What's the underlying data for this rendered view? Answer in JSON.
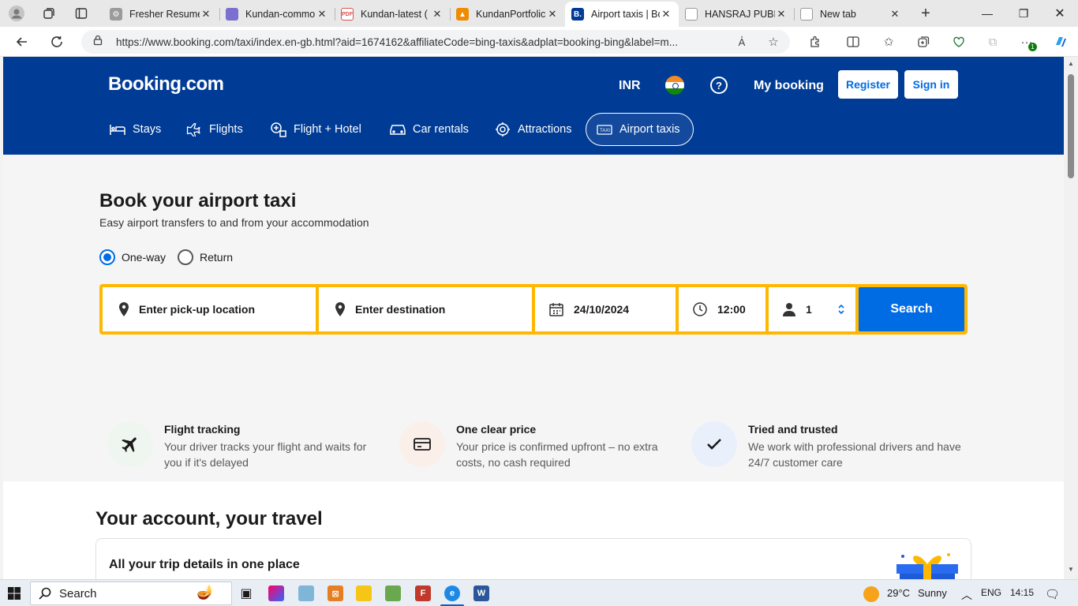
{
  "browser": {
    "tabs": [
      {
        "title": "Fresher Resume",
        "favicon": "gear-icon",
        "color": "#888888"
      },
      {
        "title": "Kundan-commo",
        "favicon": "doc-icon",
        "color": "#7b6fd0"
      },
      {
        "title": "Kundan-latest (",
        "favicon": "pdf-icon",
        "color": "#d9534f"
      },
      {
        "title": "KundanPortfolic",
        "favicon": "portfolio-icon",
        "color": "#f08a00"
      },
      {
        "title": "Airport taxis | Bo",
        "favicon": "booking-icon",
        "color": "#003b95",
        "active": true
      },
      {
        "title": "HANSRAJ PUBL",
        "favicon": "page-icon",
        "color": "#999999"
      },
      {
        "title": "New tab",
        "favicon": "newtab-icon",
        "color": "#999999"
      }
    ],
    "url": "https://www.booking.com/taxi/index.en-gb.html?aid=1674162&affiliateCode=bing-taxis&adplat=booking-bing&label=m...",
    "extension_badge": "1"
  },
  "header": {
    "logo": "Booking.com",
    "currency": "INR",
    "help": "?",
    "my_booking": "My booking",
    "register": "Register",
    "sign_in": "Sign in",
    "brand_color": "#003b95"
  },
  "nav": [
    {
      "label": "Stays",
      "icon": "bed-icon"
    },
    {
      "label": "Flights",
      "icon": "plane-icon"
    },
    {
      "label": "Flight + Hotel",
      "icon": "plane-hotel-icon"
    },
    {
      "label": "Car rentals",
      "icon": "car-icon"
    },
    {
      "label": "Attractions",
      "icon": "attractions-icon"
    },
    {
      "label": "Airport taxis",
      "icon": "taxi-icon",
      "active": true
    }
  ],
  "hero": {
    "title": "Book your airport taxi",
    "subtitle": "Easy airport transfers to and from your accommodation",
    "trip_types": [
      {
        "label": "One-way",
        "selected": true
      },
      {
        "label": "Return",
        "selected": false
      }
    ]
  },
  "search": {
    "pickup_placeholder": "Enter pick-up location",
    "destination_placeholder": "Enter destination",
    "date": "24/10/2024",
    "time": "12:00",
    "passengers": "1",
    "button": "Search",
    "accent": "#ffb700",
    "button_color": "#006ce4"
  },
  "features": [
    {
      "title": "Flight tracking",
      "desc": "Your driver tracks your flight and waits for you if it's delayed",
      "icon": "plane-icon",
      "bg": "#eef6ef"
    },
    {
      "title": "One clear price",
      "desc": "Your price is confirmed upfront – no extra costs, no cash required",
      "icon": "card-icon",
      "bg": "#fbefe9"
    },
    {
      "title": "Tried and trusted",
      "desc": "We work with professional drivers and have 24/7 customer care",
      "icon": "check-icon",
      "bg": "#eaf0fb"
    }
  ],
  "account": {
    "title": "Your account, your travel",
    "card_title": "All your trip details in one place"
  },
  "taskbar": {
    "search": "Search",
    "weather": "29°C",
    "weather_desc": "Sunny",
    "lang": "ENG",
    "time": "14:15"
  }
}
